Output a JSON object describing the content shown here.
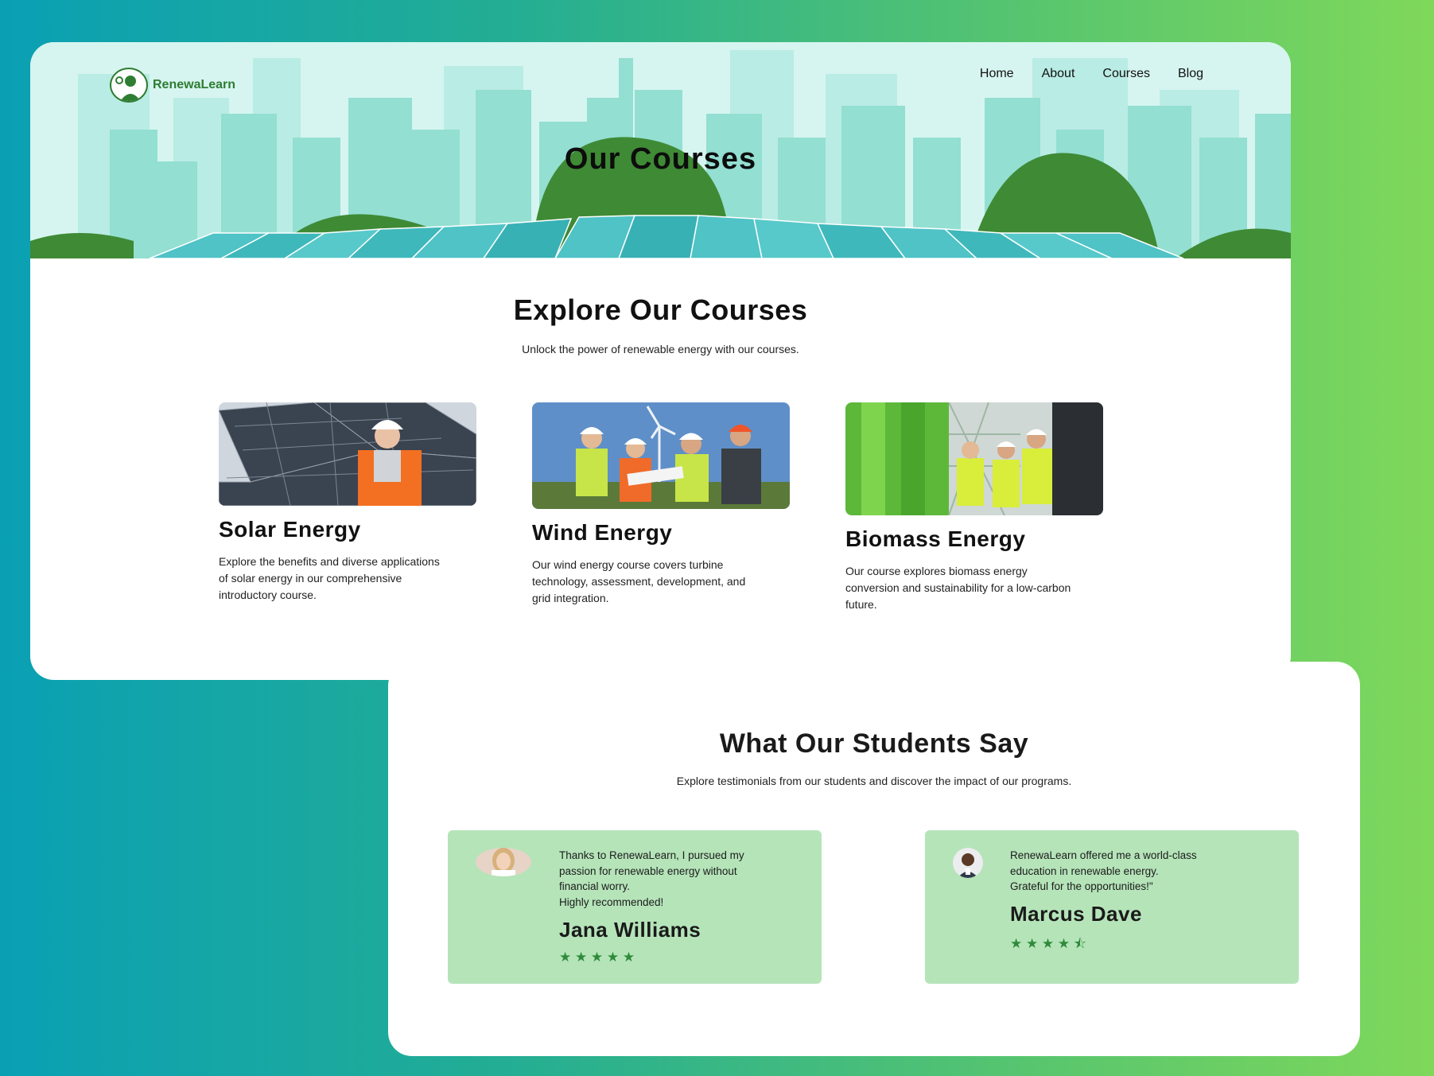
{
  "brand": {
    "name": "RenewaLearn"
  },
  "nav": {
    "items": [
      "Home",
      "About",
      "Courses",
      "Blog"
    ]
  },
  "hero": {
    "title": "Our Courses"
  },
  "explore": {
    "title": "Explore Our Courses",
    "subtitle": "Unlock the power of renewable energy with our courses."
  },
  "courses": [
    {
      "title": "Solar Energy",
      "description": "Explore the benefits and diverse applications of solar energy in our comprehensive introductory course.",
      "image": "solar-worker-photo"
    },
    {
      "title": "Wind Energy",
      "description": "Our wind energy course covers turbine technology, assessment, development, and grid integration.",
      "image": "wind-engineers-photo"
    },
    {
      "title": "Biomass Energy",
      "description": "Our course explores biomass energy conversion and sustainability for a low-carbon future.",
      "image": "biomass-plant-photo"
    }
  ],
  "testimonials": {
    "title": "What Our Students Say",
    "subtitle": "Explore testimonials from our students and discover the impact of our programs.",
    "items": [
      {
        "quote": "Thanks to RenewaLearn, I pursued my\npassion for renewable energy without\nfinancial worry.\nHighly recommended!",
        "name": "Jana Williams",
        "rating": 5,
        "stars": "★ ★ ★ ★ ★"
      },
      {
        "quote": "RenewaLearn offered me a world-class\neducation in renewable energy.\nGrateful for the opportunities!\"",
        "name": "Marcus Dave",
        "rating": 4.5,
        "stars": "★ ★ ★ ★ ⯪"
      }
    ]
  },
  "colors": {
    "brand_green": "#2e7d32",
    "hero_bg": "#d6f5f0",
    "testimonial_bg": "#b5e4b9",
    "star": "#2e8b3a"
  }
}
